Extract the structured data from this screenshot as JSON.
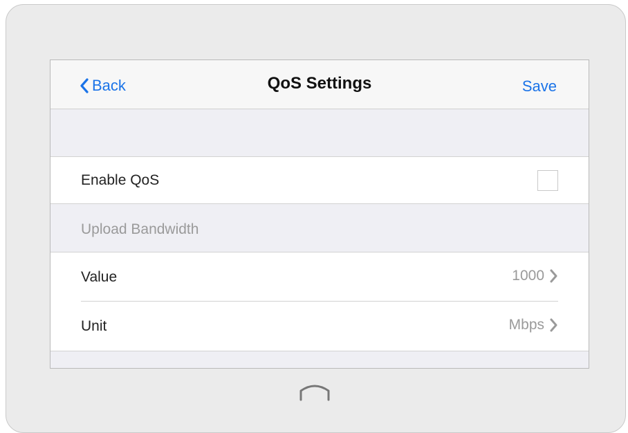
{
  "navbar": {
    "back_label": "Back",
    "title": "QoS Settings",
    "save_label": "Save"
  },
  "enable_qos": {
    "label": "Enable QoS",
    "checked": false
  },
  "upload_bandwidth": {
    "section_label": "Upload Bandwidth",
    "value": {
      "label": "Value",
      "current": "1000"
    },
    "unit": {
      "label": "Unit",
      "current": "Mbps"
    }
  },
  "icons": {
    "back": "chevron-left-icon",
    "disclosure": "chevron-right-icon",
    "home": "home-button-icon"
  },
  "colors": {
    "accent": "#1a73e8",
    "secondary_text": "#9a9a9a",
    "grouped_background": "#efeff4"
  }
}
